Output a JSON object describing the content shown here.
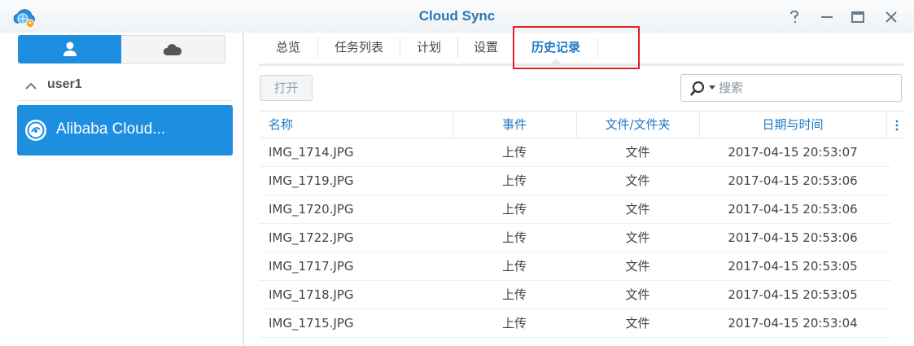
{
  "window": {
    "title": "Cloud Sync",
    "controls": [
      "help-icon",
      "minimize-icon",
      "maximize-icon",
      "close-icon"
    ]
  },
  "sidebar": {
    "view_toggle": [
      {
        "icon": "user-icon",
        "active": true
      },
      {
        "icon": "cloud-icon",
        "active": false
      }
    ],
    "group": {
      "label": "user1",
      "expanded": true
    },
    "items": [
      {
        "label": "Alibaba Cloud...",
        "icon": "alibaba-cloud-icon",
        "selected": true
      }
    ]
  },
  "tabs": [
    {
      "label": "总览",
      "active": false
    },
    {
      "label": "任务列表",
      "active": false
    },
    {
      "label": "计划",
      "active": false
    },
    {
      "label": "设置",
      "active": false
    },
    {
      "label": "历史记录",
      "active": true
    }
  ],
  "toolbar": {
    "open_label": "打开",
    "search_placeholder": "搜索"
  },
  "table": {
    "columns": [
      "名称",
      "事件",
      "文件/文件夹",
      "日期与时间"
    ],
    "rows": [
      [
        "IMG_1714.JPG",
        "上传",
        "文件",
        "2017-04-15 20:53:07"
      ],
      [
        "IMG_1719.JPG",
        "上传",
        "文件",
        "2017-04-15 20:53:06"
      ],
      [
        "IMG_1720.JPG",
        "上传",
        "文件",
        "2017-04-15 20:53:06"
      ],
      [
        "IMG_1722.JPG",
        "上传",
        "文件",
        "2017-04-15 20:53:06"
      ],
      [
        "IMG_1717.JPG",
        "上传",
        "文件",
        "2017-04-15 20:53:05"
      ],
      [
        "IMG_1718.JPG",
        "上传",
        "文件",
        "2017-04-15 20:53:05"
      ],
      [
        "IMG_1715.JPG",
        "上传",
        "文件",
        "2017-04-15 20:53:04"
      ]
    ]
  },
  "colors": {
    "accent": "#1e8fe0",
    "title": "#2a76b5",
    "highlight": "#e02020"
  }
}
